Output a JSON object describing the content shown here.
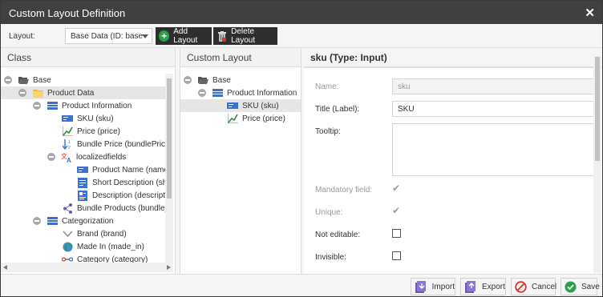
{
  "window": {
    "title": "Custom Layout Definition",
    "close_icon": "close-icon"
  },
  "toolbar": {
    "layout_label": "Layout:",
    "layout_select_value": "Base Data (ID: base",
    "add_layout_label": "Add Layout",
    "delete_layout_label": "Delete Layout"
  },
  "class_pane": {
    "header": "Class",
    "nodes": [
      {
        "label": "Base",
        "icon": "folder-open-icon"
      },
      {
        "label": "Product Data",
        "icon": "folder-yellow-icon"
      },
      {
        "label": "Product Information",
        "icon": "panel-icon"
      },
      {
        "label": "SKU (sku)",
        "icon": "input-icon"
      },
      {
        "label": "Price (price)",
        "icon": "numeric-icon"
      },
      {
        "label": "Bundle Price (bundlePrice)",
        "icon": "sort-numeric-icon"
      },
      {
        "label": "localizedfields",
        "icon": "translate-icon"
      },
      {
        "label": "Product Name (name)",
        "icon": "input-icon"
      },
      {
        "label": "Short Description (shor",
        "icon": "textarea-icon"
      },
      {
        "label": "Description (description",
        "icon": "wysiwyg-icon"
      },
      {
        "label": "Bundle Products (bundle_pr",
        "icon": "relation-icon"
      },
      {
        "label": "Categorization",
        "icon": "panel-icon"
      },
      {
        "label": "Brand (brand)",
        "icon": "chevron-icon"
      },
      {
        "label": "Made In (made_in)",
        "icon": "globe-icon"
      },
      {
        "label": "Category (category)",
        "icon": "link-icon"
      }
    ]
  },
  "layout_pane": {
    "header": "Custom Layout",
    "nodes": [
      {
        "label": "Base",
        "icon": "folder-open-icon"
      },
      {
        "label": "Product Information",
        "icon": "panel-icon"
      },
      {
        "label": "SKU (sku)",
        "icon": "input-icon"
      },
      {
        "label": "Price (price)",
        "icon": "numeric-icon"
      }
    ]
  },
  "props": {
    "header": "sku (Type: Input)",
    "name_label": "Name:",
    "name_value": "sku",
    "title_label": "Title (Label):",
    "title_value": "SKU",
    "tooltip_label": "Tooltip:",
    "mandatory_label": "Mandatory field:",
    "unique_label": "Unique:",
    "not_editable_label": "Not editable:",
    "invisible_label": "Invisible:"
  },
  "footer": {
    "import_label": "Import",
    "export_label": "Export",
    "cancel_label": "Cancel",
    "save_label": "Save"
  },
  "colors": {
    "titlebar": "#404040",
    "accent_green": "#2aa04a",
    "cancel_red": "#d9342b",
    "icon_blue": "#3b6fd1",
    "icon_purple": "#6d5ab0"
  }
}
